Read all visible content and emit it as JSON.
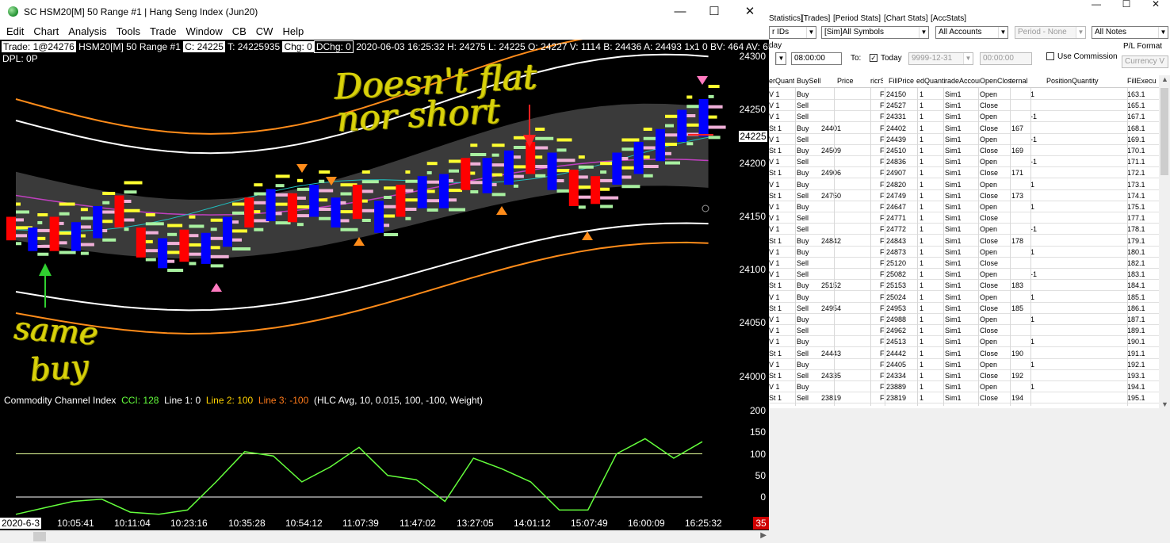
{
  "window": {
    "title": "SC HSM20[M]  50 Range  #1 | Hang Seng Index (Jun20)",
    "minimize": "—",
    "maximize": "☐",
    "close": "✕"
  },
  "menu": [
    "Edit",
    "Chart",
    "Analysis",
    "Tools",
    "Trade",
    "Window",
    "CB",
    "CW",
    "Help"
  ],
  "infobar": {
    "trade": "Trade: 1@24276",
    "symbol": "HSM20[M]  50 Range  #1",
    "close": "C: 24225",
    "ticks": "T: 24225935",
    "chg": "Chg: 0",
    "dchg": "DChg: 0",
    "details": "2020-06-03 16:25:32 H: 24275 L: 24225 O: 24227 V: 1114 B: 24436 A: 24493 1x1 0 BV: 464 AV: 650 DV:",
    "dpl": "DPL: 0P"
  },
  "price_axis": {
    "labels": [
      "24300",
      "24250",
      "24200",
      "24150",
      "24100",
      "24050",
      "24000"
    ],
    "current": "24225"
  },
  "annotations": {
    "top_line1": "Doesn't flat",
    "top_line2": "nor short",
    "bottom_line1": "same",
    "bottom_line2": "buy"
  },
  "cci_legend": {
    "name": "Commodity Channel Index",
    "cci": "CCI: 128",
    "line1": "Line 1: 0",
    "line2": "Line 2: 100",
    "line3": "Line 3: -100",
    "params": "(HLC Avg, 10, 0.015, 100, -100, Weight)"
  },
  "cci_axis": [
    "200",
    "150",
    "100",
    "50",
    "0"
  ],
  "time_axis": [
    "2020-6-3",
    "10:05:41",
    "10:11:04",
    "10:23:16",
    "10:35:28",
    "10:54:12",
    "11:07:39",
    "11:47:02",
    "13:27:05",
    "14:01:12",
    "15:07:49",
    "16:00:09",
    "16:25:32"
  ],
  "bar_count": "35",
  "colors": {
    "background": "#000000",
    "bull_bar": "#0000ff",
    "bear_bar": "#ff0000",
    "band": "#3a3a3a",
    "outer_band": "#ff8c1a",
    "mid_band": "#d0d0d0",
    "ma": "#c040c0",
    "cci_line": "#64ff3c",
    "annotation": "#d9d20a"
  },
  "chart_data": {
    "type": "candlestick",
    "x": [
      "10:05:41",
      "10:11:04",
      "10:23:16",
      "10:35:28",
      "10:54:12",
      "11:07:39",
      "11:47:02",
      "13:27:05",
      "14:01:12",
      "15:07:49",
      "16:00:09",
      "16:25:32"
    ],
    "price_ylim": [
      23975,
      24310
    ],
    "cci_ylim": [
      -30,
      200
    ],
    "cci_levels": [
      100,
      0,
      -100
    ],
    "last_close": 24225
  },
  "trade_window": {
    "tabs": [
      "Statistics]",
      "[Trades]",
      "[Period Stats]",
      "[Chart Stats]",
      "[AccStats]"
    ],
    "filters": {
      "ids": "r IDs",
      "symbols": "[Sim]All Symbols",
      "accounts": "All Accounts",
      "period": "Period - None",
      "notes": "All Notes",
      "day_label": "day",
      "from_time": "08:00:00",
      "to_label": "To:",
      "today_label": "Today",
      "to_date": "9999-12-31",
      "to_time": "00:00:00",
      "commission_label": "Use Commission",
      "pl_format_label": "P/L Format",
      "pl_format_value": "Currency V"
    },
    "columns": [
      "erQuantit",
      "BuySell",
      "Price",
      "ricrS",
      "FillPrice",
      "edQuanti",
      "radeAccoun",
      "OpenClose",
      "ternal",
      "PositionQuantity",
      "FillExecu"
    ],
    "rows": [
      [
        "V 1",
        "Buy",
        "",
        "Fi",
        "24150",
        "1",
        "Sim1",
        "Open",
        "",
        "1",
        "163.1"
      ],
      [
        "V 1",
        "Sell",
        "",
        "Fi",
        "24527",
        "1",
        "Sim1",
        "Close",
        "",
        "",
        "165.1"
      ],
      [
        "V 1",
        "Sell",
        "",
        "Fi",
        "24331",
        "1",
        "Sim1",
        "Open",
        "",
        "-1",
        "167.1"
      ],
      [
        "St 1",
        "Buy",
        "24401",
        "Fi",
        "24402",
        "1",
        "Sim1",
        "Close",
        "167",
        "",
        "168.1"
      ],
      [
        "V 1",
        "Sell",
        "",
        "Fi",
        "24439",
        "1",
        "Sim1",
        "Open",
        "",
        "-1",
        "169.1"
      ],
      [
        "St 1",
        "Buy",
        "24509",
        "Fi",
        "24510",
        "1",
        "Sim1",
        "Close",
        "169",
        "",
        "170.1"
      ],
      [
        "V 1",
        "Sell",
        "",
        "Fi",
        "24836",
        "1",
        "Sim1",
        "Open",
        "",
        "-1",
        "171.1"
      ],
      [
        "St 1",
        "Buy",
        "24906",
        "Fi",
        "24907",
        "1",
        "Sim1",
        "Close",
        "171",
        "",
        "172.1"
      ],
      [
        "V 1",
        "Buy",
        "",
        "Fi",
        "24820",
        "1",
        "Sim1",
        "Open",
        "",
        "1",
        "173.1"
      ],
      [
        "St 1",
        "Sell",
        "24750",
        "Fi",
        "24749",
        "1",
        "Sim1",
        "Close",
        "173",
        "",
        "174.1"
      ],
      [
        "V 1",
        "Buy",
        "",
        "Fi",
        "24647",
        "1",
        "Sim1",
        "Open",
        "",
        "1",
        "175.1"
      ],
      [
        "V 1",
        "Sell",
        "",
        "Fi",
        "24771",
        "1",
        "Sim1",
        "Close",
        "",
        "",
        "177.1"
      ],
      [
        "V 1",
        "Sell",
        "",
        "Fi",
        "24772",
        "1",
        "Sim1",
        "Open",
        "",
        "-1",
        "178.1"
      ],
      [
        "St 1",
        "Buy",
        "24842",
        "Fi",
        "24843",
        "1",
        "Sim1",
        "Close",
        "178",
        "",
        "179.1"
      ],
      [
        "V 1",
        "Buy",
        "",
        "Fi",
        "24873",
        "1",
        "Sim1",
        "Open",
        "",
        "1",
        "180.1"
      ],
      [
        "V 1",
        "Sell",
        "",
        "Fi",
        "25120",
        "1",
        "Sim1",
        "Close",
        "",
        "",
        "182.1"
      ],
      [
        "V 1",
        "Sell",
        "",
        "Fi",
        "25082",
        "1",
        "Sim1",
        "Open",
        "",
        "-1",
        "183.1"
      ],
      [
        "St 1",
        "Buy",
        "25152",
        "Fi",
        "25153",
        "1",
        "Sim1",
        "Close",
        "183",
        "",
        "184.1"
      ],
      [
        "V 1",
        "Buy",
        "",
        "Fi",
        "25024",
        "1",
        "Sim1",
        "Open",
        "",
        "1",
        "185.1"
      ],
      [
        "St 1",
        "Sell",
        "24954",
        "Fi",
        "24953",
        "1",
        "Sim1",
        "Close",
        "185",
        "",
        "186.1"
      ],
      [
        "V 1",
        "Buy",
        "",
        "Fi",
        "24988",
        "1",
        "Sim1",
        "Open",
        "",
        "1",
        "187.1"
      ],
      [
        "V 1",
        "Sell",
        "",
        "Fi",
        "24962",
        "1",
        "Sim1",
        "Close",
        "",
        "",
        "189.1"
      ],
      [
        "V 1",
        "Buy",
        "",
        "Fi",
        "24513",
        "1",
        "Sim1",
        "Open",
        "",
        "1",
        "190.1"
      ],
      [
        "St 1",
        "Sell",
        "24443",
        "Fi",
        "24442",
        "1",
        "Sim1",
        "Close",
        "190",
        "",
        "191.1"
      ],
      [
        "V 1",
        "Buy",
        "",
        "Fi",
        "24405",
        "1",
        "Sim1",
        "Open",
        "",
        "1",
        "192.1"
      ],
      [
        "St 1",
        "Sell",
        "24335",
        "Fi",
        "24334",
        "1",
        "Sim1",
        "Close",
        "192",
        "",
        "193.1"
      ],
      [
        "V 1",
        "Buy",
        "",
        "Fi",
        "23889",
        "1",
        "Sim1",
        "Open",
        "",
        "1",
        "194.1"
      ],
      [
        "St 1",
        "Sell",
        "23819",
        "Fi",
        "23819",
        "1",
        "Sim1",
        "Close",
        "194",
        "",
        "195.1"
      ]
    ]
  }
}
